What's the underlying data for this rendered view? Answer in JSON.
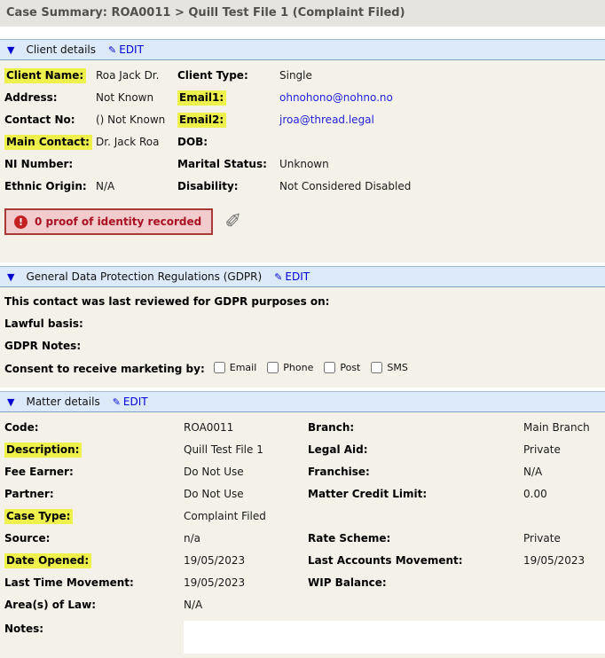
{
  "page": {
    "title": "Case Summary: ROA0011 > Quill Test File 1 (Complaint Filed)"
  },
  "colors": {
    "titlebar_bg": "#e6e4e1",
    "section_header_bg": "#dce9f8",
    "section_bg": "#f4f1e8",
    "highlight_yellow": "#eef04b",
    "link_blue": "#2222dd",
    "edit_blue": "#0000dd",
    "warning_text_red": "#aa1122",
    "warning_bg": "#f2cccc",
    "warning_border": "#a93939"
  },
  "sections": {
    "client": {
      "title": "Client details",
      "edit_label": "EDIT",
      "rows": [
        {
          "label1": "Client Name:",
          "hl1": true,
          "value1": "Roa Jack Dr.",
          "label2": "Client Type:",
          "hl2": false,
          "value2": "Single",
          "link2": false
        },
        {
          "label1": "Address:",
          "hl1": false,
          "value1": "Not Known",
          "label2": "Email1:",
          "hl2": true,
          "value2": "ohnohono@nohno.no",
          "link2": true
        },
        {
          "label1": "Contact No:",
          "hl1": false,
          "value1": "() Not Known",
          "label2": "Email2:",
          "hl2": true,
          "value2": "jroa@thread.legal",
          "link2": true
        },
        {
          "label1": "Main Contact:",
          "hl1": true,
          "value1": "Dr. Jack Roa",
          "label2": "DOB:",
          "hl2": false,
          "value2": "",
          "link2": false
        },
        {
          "label1": "NI Number:",
          "hl1": false,
          "value1": "",
          "label2": "Marital Status:",
          "hl2": false,
          "value2": "Unknown",
          "link2": false
        },
        {
          "label1": "Ethnic Origin:",
          "hl1": false,
          "value1": "N/A",
          "label2": "Disability:",
          "hl2": false,
          "value2": "Not Considered Disabled",
          "link2": false
        }
      ],
      "identity_warning": "0 proof of identity recorded"
    },
    "gdpr": {
      "title": "General Data Protection Regulations (GDPR)",
      "edit_label": "EDIT",
      "lines": [
        "This contact was last reviewed for GDPR purposes on:",
        "Lawful basis:",
        "GDPR Notes:"
      ],
      "consent_label": "Consent to receive marketing by:",
      "consent_options": [
        "Email",
        "Phone",
        "Post",
        "SMS"
      ]
    },
    "matter": {
      "title": "Matter details",
      "edit_label": "EDIT",
      "rows": [
        {
          "label1": "Code:",
          "hl1": false,
          "value1": "ROA0011",
          "label2": "Branch:",
          "hl2": false,
          "value2": "Main Branch",
          "link2": false
        },
        {
          "label1": "Description:",
          "hl1": true,
          "value1": "Quill Test File 1",
          "label2": "Legal Aid:",
          "hl2": false,
          "value2": "Private",
          "link2": false
        },
        {
          "label1": "Fee Earner:",
          "hl1": false,
          "value1": "Do Not Use",
          "label2": "Franchise:",
          "hl2": false,
          "value2": "N/A",
          "link2": false
        },
        {
          "label1": "Partner:",
          "hl1": false,
          "value1": "Do Not Use",
          "label2": "Matter Credit Limit:",
          "hl2": false,
          "value2": "0.00",
          "link2": false
        },
        {
          "label1": "Case Type:",
          "hl1": true,
          "value1": "Complaint Filed",
          "label2": "",
          "hl2": false,
          "value2": "",
          "link2": false
        },
        {
          "label1": "Source:",
          "hl1": false,
          "value1": "n/a",
          "label2": "Rate Scheme:",
          "hl2": false,
          "value2": "Private",
          "link2": false
        },
        {
          "label1": "Date Opened:",
          "hl1": true,
          "value1": "19/05/2023",
          "label2": "Last Accounts Movement:",
          "hl2": false,
          "value2": "19/05/2023",
          "link2": false
        },
        {
          "label1": "Last Time Movement:",
          "hl1": false,
          "value1": "19/05/2023",
          "label2": "WIP Balance:",
          "hl2": false,
          "value2": "",
          "link2": false
        },
        {
          "label1": "Area(s) of Law:",
          "hl1": false,
          "value1": "N/A",
          "label2": "",
          "hl2": false,
          "value2": "",
          "link2": false
        }
      ],
      "notes_label": "Notes:"
    }
  }
}
